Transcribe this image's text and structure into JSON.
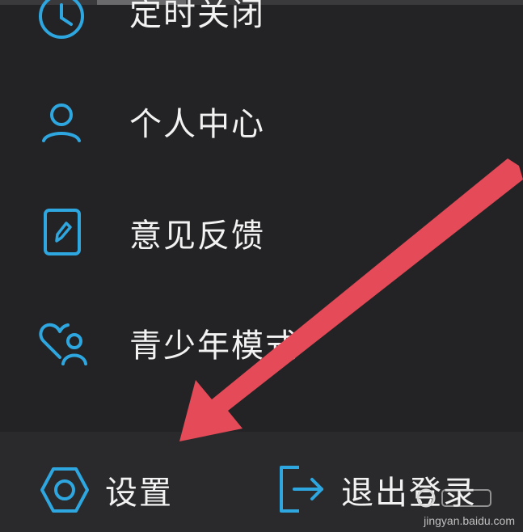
{
  "menu": {
    "items": [
      {
        "label": "定时关闭",
        "icon": "clock-icon"
      },
      {
        "label": "个人中心",
        "icon": "user-icon"
      },
      {
        "label": "意见反馈",
        "icon": "feedback-edit-icon"
      },
      {
        "label": "青少年模式",
        "icon": "heart-person-icon"
      }
    ]
  },
  "bottom": {
    "settings_label": "设置",
    "logout_label": "退出登录"
  },
  "annotation": {
    "type": "red-arrow",
    "color": "#e44a57",
    "target": "settings"
  },
  "watermark": {
    "text": "jingyan.baidu.com"
  },
  "colors": {
    "background": "#232325",
    "icon_accent": "#2ea7e0",
    "text": "#f2f2f2"
  }
}
